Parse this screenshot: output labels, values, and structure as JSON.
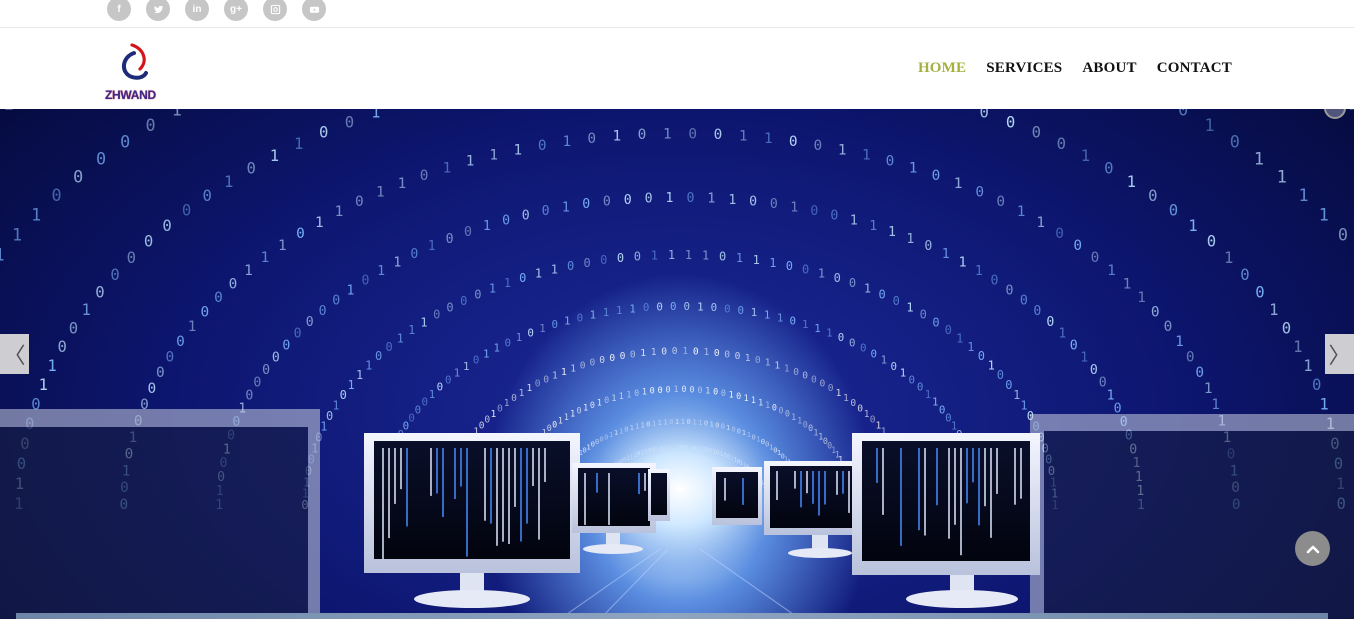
{
  "social": [
    {
      "name": "facebook-icon",
      "glyph": "f"
    },
    {
      "name": "twitter-icon",
      "glyph": ""
    },
    {
      "name": "linkedin-icon",
      "glyph": "in"
    },
    {
      "name": "google-plus-icon",
      "glyph": "g+"
    },
    {
      "name": "instagram-icon",
      "glyph": ""
    },
    {
      "name": "youtube-icon",
      "glyph": ""
    }
  ],
  "logo": {
    "text": "ZHWAND"
  },
  "nav": {
    "home": "HOME",
    "services": "SERVICES",
    "about": "ABOUT",
    "contact": "CONTACT"
  },
  "slider": {
    "prev_glyph": "〈",
    "next_glyph": "〉"
  },
  "colors": {
    "nav_active": "#a4b13e",
    "hero_bg": "#0d1670",
    "social_bg": "#c6c6c6"
  }
}
